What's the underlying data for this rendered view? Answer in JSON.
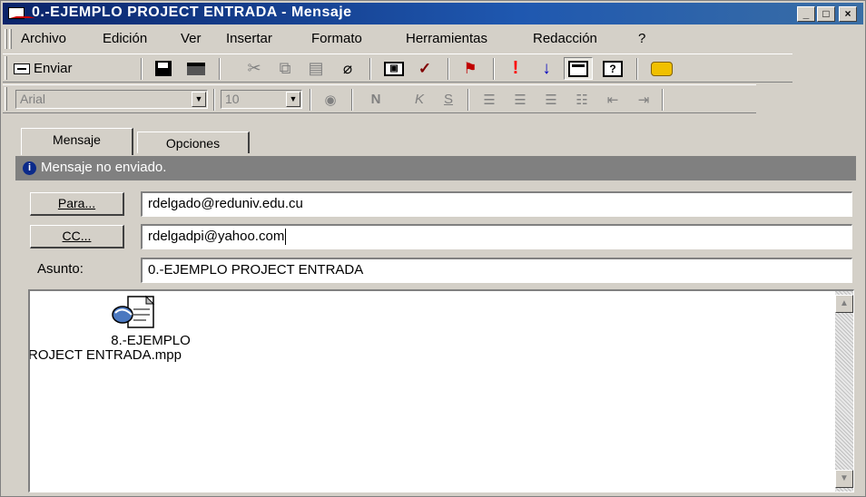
{
  "window": {
    "title": "0.-EJEMPLO PROJECT ENTRADA - Mensaje",
    "controls": {
      "minimize": "_",
      "maximize": "□",
      "close": "×"
    }
  },
  "menu": [
    "Archivo",
    "Edición",
    "Ver",
    "Insertar",
    "Formato",
    "Herramientas",
    "Redacción",
    "?"
  ],
  "toolbar": {
    "send_label": "Enviar",
    "icons": [
      "save-icon",
      "print-icon",
      "cut-icon",
      "copy-icon",
      "paste-icon",
      "attach-icon",
      "address-book-icon",
      "spellcheck-icon",
      "flag-icon",
      "high-importance-icon",
      "low-importance-icon",
      "options-icon",
      "help-icon",
      "drive-icon"
    ]
  },
  "format": {
    "font": "Arial",
    "size": "10"
  },
  "tabs": [
    "Mensaje",
    "Opciones"
  ],
  "info": "Mensaje no enviado.",
  "fields": {
    "to_label": "Para...",
    "to_value": "rdelgado@reduniv.edu.cu",
    "cc_label": "CC...",
    "cc_value": "rdelgadpi@yahoo.com",
    "subject_label": "Asunto:",
    "subject_value": "0.-EJEMPLO PROJECT ENTRADA"
  },
  "attachment": {
    "name_line1": "8.-EJEMPLO",
    "name_line2": "ROJECT ENTRADA.mpp"
  }
}
